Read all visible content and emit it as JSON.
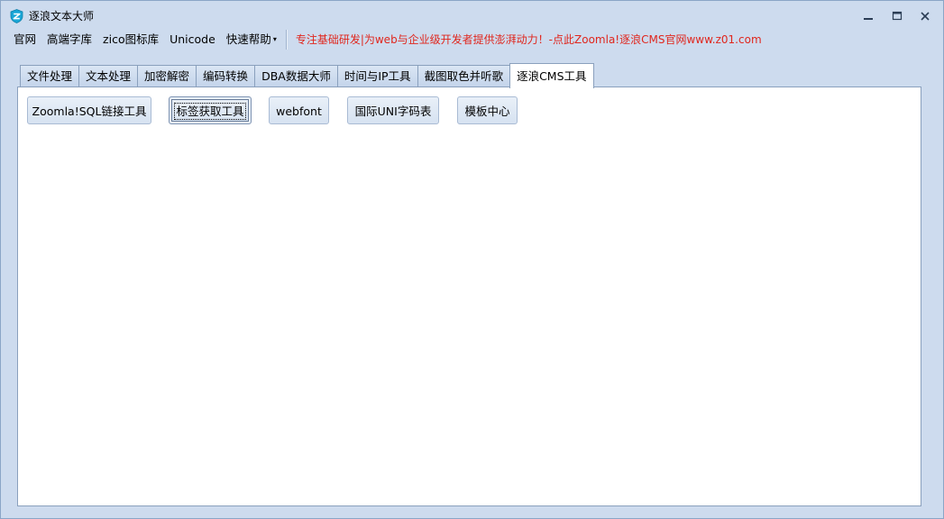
{
  "window": {
    "title": "逐浪文本大师",
    "controls": {
      "minimize": "minimize-icon",
      "maximize": "maximize-icon",
      "close": "close-icon"
    }
  },
  "menu": {
    "items": [
      {
        "label": "官网"
      },
      {
        "label": "高端字库"
      },
      {
        "label": "zico图标库"
      },
      {
        "label": "Unicode"
      },
      {
        "label": "快速帮助",
        "has_dropdown": true
      }
    ],
    "dropdown_caret": "▾",
    "promo_text": "专注基础研发|为web与企业级开发者提供澎湃动力！-点此Zoomla!逐浪CMS官网www.z01.com",
    "promo_color": "#e0261d"
  },
  "tabs": [
    {
      "label": "文件处理"
    },
    {
      "label": "文本处理"
    },
    {
      "label": "加密解密"
    },
    {
      "label": "编码转换"
    },
    {
      "label": "DBA数据大师"
    },
    {
      "label": "时间与IP工具"
    },
    {
      "label": "截图取色并听歌"
    },
    {
      "label": "逐浪CMS工具",
      "active": true
    }
  ],
  "tools": [
    {
      "label": "Zoomla!SQL链接工具"
    },
    {
      "label": "标签获取工具",
      "focused": true
    },
    {
      "label": "webfont"
    },
    {
      "label": "国际UNI字码表"
    },
    {
      "label": "模板中心"
    }
  ],
  "colors": {
    "window_bg": "#cddbee",
    "panel_bg": "#ffffff",
    "border": "#8aa0bd",
    "app_icon": "#1aa6d6"
  }
}
